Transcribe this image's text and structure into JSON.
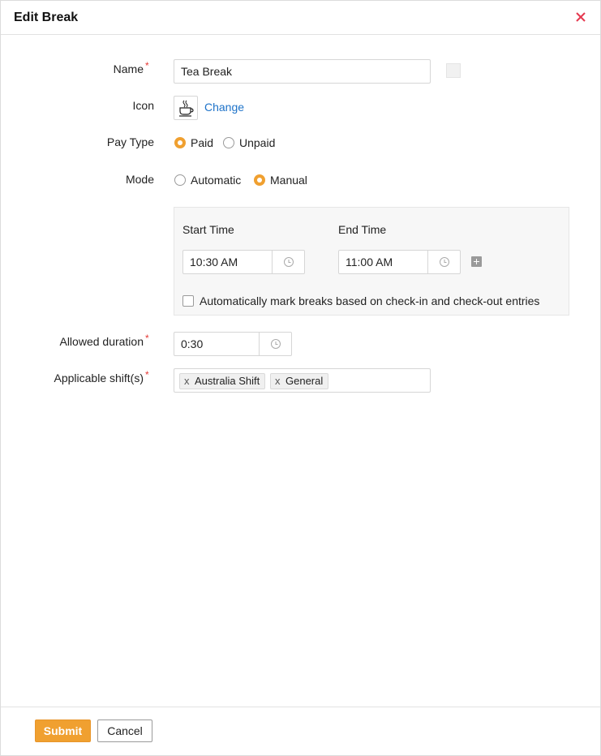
{
  "dialog": {
    "title": "Edit Break"
  },
  "form": {
    "name": {
      "label": "Name",
      "required_mark": "*",
      "value": "Tea Break"
    },
    "icon": {
      "label": "Icon",
      "change_link": "Change",
      "icon_name": "coffee-cup-icon"
    },
    "pay_type": {
      "label": "Pay Type",
      "options": [
        "Paid",
        "Unpaid"
      ],
      "selected": "Paid"
    },
    "mode": {
      "label": "Mode",
      "options": [
        "Automatic",
        "Manual"
      ],
      "selected": "Manual"
    },
    "manual": {
      "start_time_label": "Start Time",
      "start_time_value": "10:30 AM",
      "end_time_label": "End Time",
      "end_time_value": "11:00 AM",
      "auto_mark_label": "Automatically mark breaks based on check-in and check-out entries",
      "auto_mark_checked": false
    },
    "allowed_duration": {
      "label": "Allowed duration",
      "required_mark": "*",
      "value": "0:30"
    },
    "applicable_shifts": {
      "label": "Applicable shift(s)",
      "required_mark": "*",
      "tags": [
        "Australia Shift",
        "General"
      ],
      "remove_glyph": "x"
    }
  },
  "footer": {
    "submit_label": "Submit",
    "cancel_label": "Cancel"
  },
  "colors": {
    "accent": "#f0a030",
    "link": "#1e73c9",
    "required": "#e53935",
    "close": "#e53950"
  }
}
